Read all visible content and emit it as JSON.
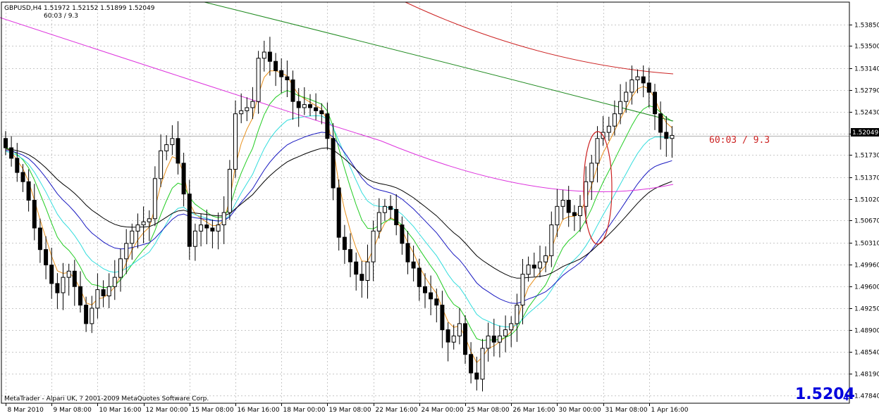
{
  "header": {
    "symbol_line": "GBPUSD,H4  1.51972 1.52152 1.51899 1.52049",
    "indicator_line": "60:03 / 9.3"
  },
  "footer": {
    "copyright": "MetaTrader - Alpari UK, ? 2001-2009 MetaQuotes Software Corp."
  },
  "bid": {
    "main": "1.5204",
    "sub": "4",
    "label": "1.52049"
  },
  "annotation": {
    "text": "60:03 / 9.3",
    "color": "#cc2222"
  },
  "colors": {
    "background": "#ffffff",
    "grid": "#c8c8c8",
    "candle": "#000000",
    "ma_orange": "#e8901c",
    "ma_green": "#22cc22",
    "ma_cyan": "#33dddd",
    "ma_blue": "#1818c0",
    "ma_black": "#000000",
    "ma_magenta": "#dd33dd",
    "ma_darkgreen": "#1f8a1f",
    "ma_red": "#cc2222",
    "bid_text": "#0000dd"
  },
  "chart_data": {
    "type": "candlestick",
    "title": "GBPUSD,H4",
    "ylim": [
      1.4771,
      1.5421
    ],
    "y_ticks": [
      1.5385,
      1.535,
      1.5314,
      1.5279,
      1.5243,
      1.5208,
      1.5173,
      1.5137,
      1.5102,
      1.5067,
      1.5031,
      1.4996,
      1.496,
      1.4925,
      1.489,
      1.4854,
      1.4819,
      1.4784
    ],
    "y_tick_labels": [
      "1.53850",
      "1.53500",
      "1.53140",
      "1.52790",
      "1.52430",
      "1.52080",
      "1.51730",
      "1.51370",
      "1.51020",
      "1.50670",
      "1.50310",
      "1.49960",
      "1.49600",
      "1.49250",
      "1.48900",
      "1.48540",
      "1.48190",
      "1.47840"
    ],
    "x_ticks": [
      {
        "label": "8 Mar 2010",
        "index": 0
      },
      {
        "label": "9 Mar 08:00",
        "index": 8
      },
      {
        "label": "10 Mar 16:00",
        "index": 16
      },
      {
        "label": "12 Mar 00:00",
        "index": 24
      },
      {
        "label": "15 Mar 08:00",
        "index": 32
      },
      {
        "label": "16 Mar 16:00",
        "index": 40
      },
      {
        "label": "18 Mar 00:00",
        "index": 48
      },
      {
        "label": "19 Mar 08:00",
        "index": 56
      },
      {
        "label": "22 Mar 16:00",
        "index": 64
      },
      {
        "label": "24 Mar 00:00",
        "index": 72
      },
      {
        "label": "25 Mar 08:00",
        "index": 80
      },
      {
        "label": "26 Mar 16:00",
        "index": 88
      },
      {
        "label": "30 Mar 00:00",
        "index": 96
      },
      {
        "label": "31 Mar 08:00",
        "index": 104
      },
      {
        "label": "1 Apr 16:00",
        "index": 112
      }
    ],
    "bid_line": 1.52049,
    "closes": [
      1.5185,
      1.5168,
      1.5145,
      1.513,
      1.51,
      1.5055,
      1.502,
      1.4995,
      1.4965,
      1.495,
      1.4975,
      1.4985,
      1.496,
      1.493,
      1.49,
      1.4925,
      1.4955,
      1.4945,
      1.496,
      1.4975,
      1.5005,
      1.503,
      1.505,
      1.506,
      1.5065,
      1.507,
      1.5135,
      1.518,
      1.519,
      1.52,
      1.516,
      1.511,
      1.5025,
      1.505,
      1.506,
      1.5055,
      1.505,
      1.506,
      1.508,
      1.515,
      1.524,
      1.5245,
      1.525,
      1.526,
      1.533,
      1.534,
      1.5325,
      1.531,
      1.53,
      1.5295,
      1.526,
      1.525,
      1.5255,
      1.525,
      1.5245,
      1.524,
      1.52,
      1.512,
      1.504,
      1.502,
      1.5,
      1.498,
      1.497,
      1.5,
      1.505,
      1.508,
      1.509,
      1.5085,
      1.506,
      1.503,
      1.5,
      1.499,
      1.496,
      1.495,
      1.494,
      1.493,
      1.489,
      1.487,
      1.488,
      1.49,
      1.485,
      1.482,
      1.481,
      1.486,
      1.488,
      1.487,
      1.488,
      1.489,
      1.49,
      1.493,
      1.498,
      1.4995,
      1.499,
      1.5,
      1.501,
      1.506,
      1.509,
      1.51,
      1.508,
      1.5075,
      1.509,
      1.513,
      1.516,
      1.52,
      1.521,
      1.522,
      1.524,
      1.526,
      1.5275,
      1.5295,
      1.53,
      1.529,
      1.5275,
      1.524,
      1.521,
      1.52,
      1.5205
    ]
  }
}
